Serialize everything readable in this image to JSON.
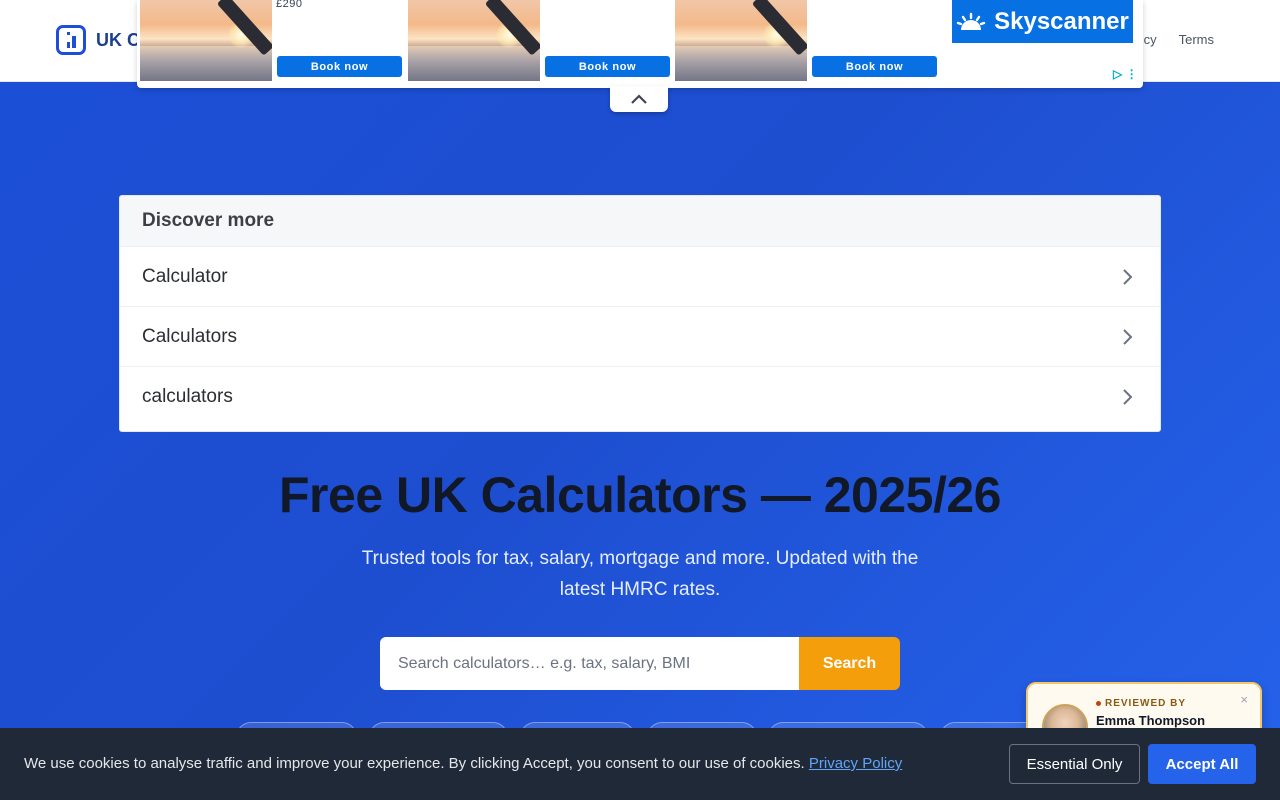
{
  "header": {
    "logo_text": "UK C",
    "nav": [
      "cy",
      "Terms"
    ]
  },
  "ad": {
    "price": "£290",
    "cards": [
      {
        "button": "Book now"
      },
      {
        "button": "Book now"
      },
      {
        "button": "Book now"
      }
    ],
    "brand": "Skyscanner",
    "adchoice": "▷ ⋮"
  },
  "discover": {
    "heading": "Discover more",
    "items": [
      "Calculator",
      "Calculators",
      "calculators"
    ]
  },
  "hero": {
    "title": "Free UK Calculators — 2025/26",
    "subtitle": "Trusted tools for tax, salary, mortgage and more. Updated with the latest HMRC rates."
  },
  "search": {
    "placeholder": "Search calculators… e.g. tax, salary, BMI",
    "button": "Search"
  },
  "reviewer": {
    "label": "REVIEWED BY",
    "name": "Emma Thompson",
    "close": "×"
  },
  "cookie": {
    "text": "We use cookies to analyse traffic and improve your experience. By clicking Accept, you consent to our use of cookies.",
    "link": "Privacy Policy",
    "essential": "Essential Only",
    "accept": "Accept All"
  },
  "colors": {
    "brand_blue": "#1d4ed8",
    "hero_blue": "#1e4ed0",
    "search_orange": "#f59e0b",
    "accept_blue": "#2563eb",
    "cookie_bg": "#1f2937"
  },
  "icons": {
    "logo": "calculator-logo-icon",
    "row_chevron": "chevron-right-icon",
    "collapse": "chevron-up-icon"
  }
}
